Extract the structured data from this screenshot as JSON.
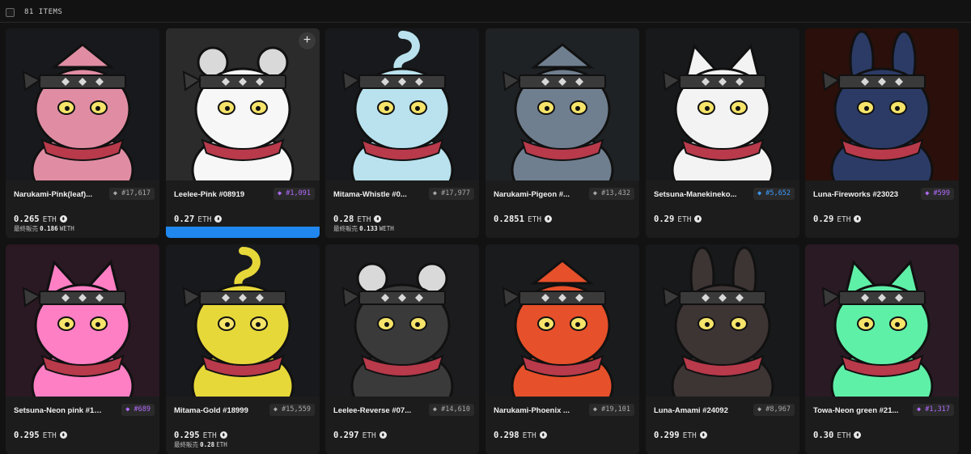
{
  "toolbar": {
    "item_count": "81 ITEMS"
  },
  "items": [
    {
      "name": "Narukami-Pink(leaf)...",
      "rank": "#17,617",
      "rank_color": "gray",
      "price": "0.265",
      "currency": "ETH",
      "last_sale_label": "最終販売",
      "last_sale_price": "0.186",
      "last_sale_currency": "WETH",
      "bg": "#17191c",
      "body": "#e08da3",
      "icon": "hawk"
    },
    {
      "name": "Leelee-Pink #08919",
      "rank": "#1,091",
      "rank_color": "purple",
      "price": "0.27",
      "currency": "ETH",
      "bg": "#2b2b2c",
      "body": "#f7f7f7",
      "icon": "panda",
      "hover": true
    },
    {
      "name": "Mitama-Whistle #0...",
      "rank": "#17,977",
      "rank_color": "gray",
      "price": "0.28",
      "currency": "ETH",
      "last_sale_label": "最終販売",
      "last_sale_price": "0.133",
      "last_sale_currency": "WETH",
      "bg": "#17191c",
      "body": "#b9e2ee",
      "icon": "ghost"
    },
    {
      "name": "Narukami-Pigeon #...",
      "rank": "#13,432",
      "rank_color": "gray",
      "price": "0.2851",
      "currency": "ETH",
      "bg": "#1f2224",
      "body": "#707f8f",
      "icon": "pigeon"
    },
    {
      "name": "Setsuna-Manekineko...",
      "rank": "#5,652",
      "rank_color": "blue",
      "price": "0.29",
      "currency": "ETH",
      "bg": "#18191b",
      "body": "#f3f3f3",
      "icon": "cat"
    },
    {
      "name": "Luna-Fireworks #23023",
      "rank": "#599",
      "rank_color": "purple",
      "price": "0.29",
      "currency": "ETH",
      "bg": "#2a0f0a",
      "body": "#2c3b66",
      "icon": "rabbit"
    },
    {
      "name": "Setsuna-Neon pink #17...",
      "rank": "#689",
      "rank_color": "purple",
      "price": "0.295",
      "currency": "ETH",
      "bg": "#2a1822",
      "body": "#ff7fc4",
      "icon": "cat"
    },
    {
      "name": "Mitama-Gold #18999",
      "rank": "#15,559",
      "rank_color": "gray",
      "price": "0.295",
      "currency": "ETH",
      "last_sale_label": "最終販売",
      "last_sale_price": "0.28",
      "last_sale_currency": "ETH",
      "bg": "#17191c",
      "body": "#e7d83a",
      "icon": "ghost"
    },
    {
      "name": "Leelee-Reverse #07...",
      "rank": "#14,610",
      "rank_color": "gray",
      "price": "0.297",
      "currency": "ETH",
      "bg": "#1c1c1e",
      "body": "#3a3a3a",
      "icon": "panda"
    },
    {
      "name": "Narukami-Phoenix ...",
      "rank": "#19,101",
      "rank_color": "gray",
      "price": "0.298",
      "currency": "ETH",
      "bg": "#1a1b1d",
      "body": "#e6502a",
      "icon": "hawk"
    },
    {
      "name": "Luna-Amami #24092",
      "rank": "#8,967",
      "rank_color": "gray",
      "price": "0.299",
      "currency": "ETH",
      "bg": "#17191b",
      "body": "#3d3434",
      "icon": "rabbit"
    },
    {
      "name": "Towa-Neon green #21...",
      "rank": "#1,317",
      "rank_color": "purple",
      "price": "0.30",
      "currency": "ETH",
      "bg": "#2a1a24",
      "body": "#5ff0a8",
      "icon": "cat"
    }
  ]
}
